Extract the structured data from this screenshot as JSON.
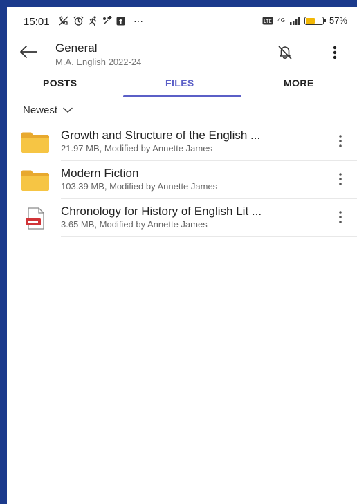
{
  "status_bar": {
    "time": "15:01",
    "ellipsis": "···",
    "network": "4G",
    "battery_text": "57%",
    "battery_level": 0.57
  },
  "header": {
    "title": "General",
    "subtitle": "M.A. English 2022-24"
  },
  "tabs": [
    {
      "label": "POSTS",
      "active": false
    },
    {
      "label": "FILES",
      "active": true
    },
    {
      "label": "MORE",
      "active": false
    }
  ],
  "sort": {
    "label": "Newest"
  },
  "files": [
    {
      "name": "Growth and Structure of the English ...",
      "meta": "21.97 MB, Modified by Annette James",
      "icon": "folder-icon"
    },
    {
      "name": "Modern Fiction",
      "meta": "103.39 MB, Modified by Annette James",
      "icon": "folder-icon"
    },
    {
      "name": "Chronology for History of English Lit ...",
      "meta": "3.65 MB, Modified by Annette James",
      "icon": "pdf-file-icon"
    }
  ],
  "colors": {
    "accent": "#5b5fc7",
    "folder": "#f6c544",
    "pdf_red": "#d13438",
    "frame": "#1b3a8c",
    "battery": "#f2b705"
  }
}
